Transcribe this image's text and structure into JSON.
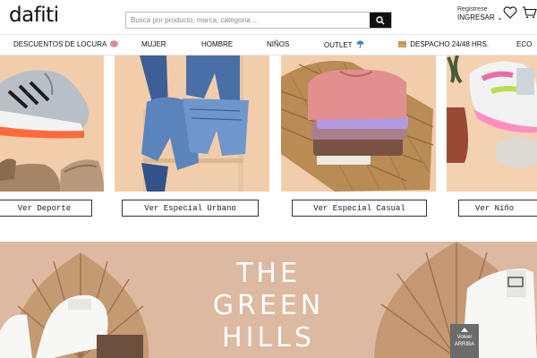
{
  "header": {
    "logo": "dafiti",
    "search_placeholder": "Busca por producto, marca, categoría ...",
    "account_register": "Registrese",
    "account_login": "INGRESAR ⌄"
  },
  "nav": {
    "items": [
      "DESCUENTOS DE LOCURA",
      "MUJER",
      "HOMBRE",
      "NIÑOS",
      "OUTLET",
      "DESPACHO 24/48 HRS.",
      "ECO"
    ]
  },
  "tiles": [
    {
      "button": "Ver Deporte"
    },
    {
      "button": "Ver Especial Urbano"
    },
    {
      "button": "Ver Especial Casual"
    },
    {
      "button": "Ver Niño"
    }
  ],
  "banner": {
    "line1": "THE",
    "line2": "GREEN",
    "line3": "HILLS"
  },
  "back_to_top": {
    "line1": "Volver",
    "line2": "ARRIBA"
  },
  "colors": {
    "tile_bg": "#eec9a6",
    "banner_bg": "#dcb9a0",
    "dark": "#111111"
  }
}
